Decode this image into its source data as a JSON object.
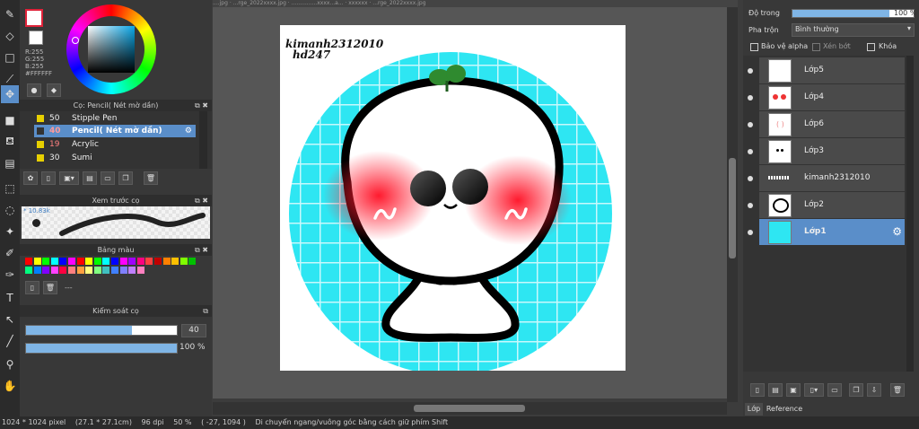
{
  "topstrip": "....jpg · ...rge_2022xxxx.jpg · ...............xxxx...a... · xxxxxx · ...rge_2022xxxx.jpg",
  "color": {
    "r": "R:255",
    "g": "G:255",
    "b": "B:255",
    "hex": "#FFFFFF",
    "fg": "#ffffff",
    "accent_red": "#e0233a"
  },
  "brush_panel": {
    "title": "Cọ: Pencil( Nét mờ dần)",
    "items": [
      {
        "size": "50",
        "name": "Stipple Pen",
        "selected": false
      },
      {
        "size": "40",
        "name": "Pencil( Nét mờ dần)",
        "selected": true
      },
      {
        "size": "19",
        "name": "Acrylic",
        "selected": false
      },
      {
        "size": "30",
        "name": "Sumi",
        "selected": false
      }
    ]
  },
  "preview_panel": {
    "title": "Xem trước cọ",
    "size_label": "* 10.83k"
  },
  "palette_panel": {
    "title": "Bảng màu",
    "dash": "---",
    "colors": [
      "#ff0000",
      "#ffff00",
      "#00ff00",
      "#00ffff",
      "#0000ff",
      "#ff00ff",
      "#ff0000",
      "#ffff00",
      "#00ff00",
      "#00ffff",
      "#0000ff",
      "#ff00ff",
      "#a000ff",
      "#ff0080",
      "#ff4040",
      "#c00000",
      "#ff8000",
      "#ffc000",
      "#80ff00",
      "#00c000",
      "#00ff80",
      "#0080ff",
      "#8000ff",
      "#ff40ff",
      "#ff0040",
      "#ff8080",
      "#ffa040",
      "#ffff80",
      "#80ff80",
      "#40c0c0",
      "#4080ff",
      "#8080ff",
      "#c080ff",
      "#ff80c0"
    ]
  },
  "control_panel": {
    "title": "Kiểm soát cọ",
    "size_value": "40",
    "size_fraction": 0.7,
    "opacity_value": "100 %",
    "opacity_fraction": 1.0
  },
  "canvas": {
    "watermark_line1": "kimanh2312010",
    "watermark_line2": "hd247"
  },
  "layer_panel": {
    "opacity_label": "Độ trong",
    "opacity_value": "100 %",
    "opacity_fraction": 1.0,
    "blend_label": "Pha trộn",
    "blend_value": "Bình thường",
    "protect_alpha": "Bảo vệ alpha",
    "clip": "Xén bớt",
    "lock": "Khóa",
    "layers": [
      {
        "name": "Lớp5",
        "selected": false
      },
      {
        "name": "Lớp4",
        "selected": false
      },
      {
        "name": "Lớp6",
        "selected": false
      },
      {
        "name": "Lớp3",
        "selected": false
      },
      {
        "name": "kimanh2312010",
        "selected": false
      },
      {
        "name": "Lớp2",
        "selected": false
      },
      {
        "name": "Lớp1",
        "selected": true
      }
    ],
    "tab_layer": "Lớp",
    "tab_reference": "Reference"
  },
  "status": {
    "size": "1024 * 1024 pixel",
    "cm": "(27.1 * 27.1cm)",
    "dpi": "96 dpi",
    "zoom": "50 %",
    "coords": "( -27, 1094 )",
    "hint": "Di chuyển ngang/vuông góc bằng cách giữ phím Shift"
  }
}
